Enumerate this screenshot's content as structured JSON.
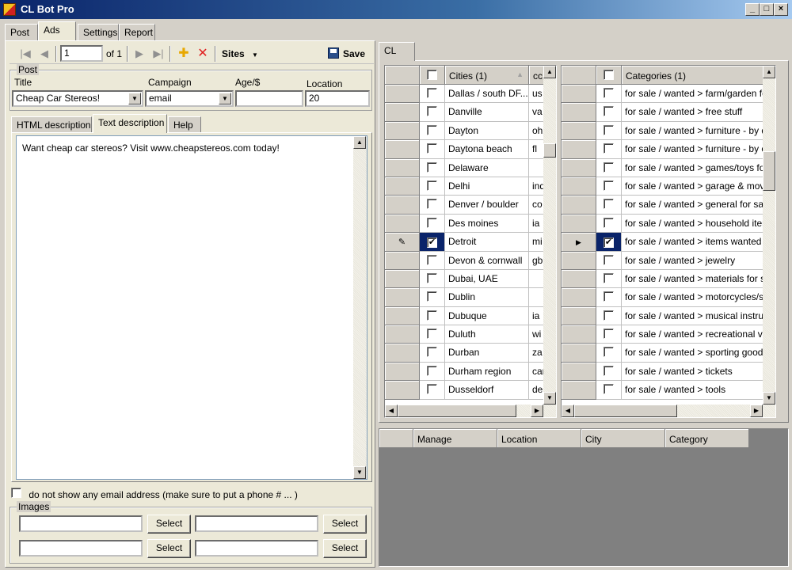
{
  "window": {
    "title": "CL Bot Pro",
    "minimize": "_",
    "maximize": "□",
    "close": "×"
  },
  "main_tabs": [
    "Post",
    "Ads",
    "Settings",
    "Report"
  ],
  "toolbar": {
    "first": "|◀",
    "prev": "◀",
    "record": "1",
    "of_label": "of 1",
    "next": "▶",
    "last": "▶|",
    "add_icon": "✚",
    "delete_icon": "✕",
    "sites_label": "Sites",
    "save_label": "Save"
  },
  "post": {
    "group_label": "Post",
    "title_label": "Title",
    "title_value": "Cheap Car Stereos!",
    "campaign_label": "Campaign",
    "campaign_value": "email",
    "age_label": "Age/$",
    "age_value": "",
    "location_label": "Location",
    "location_value": "20"
  },
  "desc_tabs": [
    "HTML description",
    "Text description",
    "Help"
  ],
  "description_text": "Want cheap car stereos?  Visit www.cheapstereos.com today!",
  "no_email_label": "do not show any email address (make sure to put a phone # ... )",
  "images": {
    "group_label": "Images",
    "select_label": "Select"
  },
  "site_tab": "CL",
  "cities": {
    "header": "Cities (1)",
    "code_header": "cc",
    "rows": [
      {
        "name": "Dallas / south DF...",
        "code": "us",
        "checked": false
      },
      {
        "name": "Danville",
        "code": "va",
        "checked": false
      },
      {
        "name": "Dayton",
        "code": "oh",
        "checked": false
      },
      {
        "name": "Daytona beach",
        "code": "fl",
        "checked": false
      },
      {
        "name": "Delaware",
        "code": "",
        "checked": false
      },
      {
        "name": "Delhi",
        "code": "ind",
        "checked": false
      },
      {
        "name": "Denver / boulder",
        "code": "co",
        "checked": false
      },
      {
        "name": "Des moines",
        "code": "ia",
        "checked": false
      },
      {
        "name": "Detroit",
        "code": "mi",
        "checked": true
      },
      {
        "name": "Devon & cornwall",
        "code": "gb",
        "checked": false
      },
      {
        "name": "Dubai, UAE",
        "code": "",
        "checked": false
      },
      {
        "name": "Dublin",
        "code": "",
        "checked": false
      },
      {
        "name": "Dubuque",
        "code": "ia",
        "checked": false
      },
      {
        "name": "Duluth",
        "code": "wi",
        "checked": false
      },
      {
        "name": "Durban",
        "code": "za",
        "checked": false
      },
      {
        "name": "Durham region",
        "code": "car",
        "checked": false
      },
      {
        "name": "Dusseldorf",
        "code": "de",
        "checked": false
      }
    ]
  },
  "categories": {
    "header": "Categories (1)",
    "rows": [
      {
        "name": "for sale / wanted > farm/garden for",
        "checked": false
      },
      {
        "name": "for sale / wanted > free stuff",
        "checked": false
      },
      {
        "name": "for sale / wanted > furniture - by de",
        "checked": false
      },
      {
        "name": "for sale / wanted > furniture - by ov",
        "checked": false
      },
      {
        "name": "for sale / wanted > games/toys for",
        "checked": false
      },
      {
        "name": "for sale / wanted > garage & movin",
        "checked": false
      },
      {
        "name": "for sale / wanted > general for sale",
        "checked": false
      },
      {
        "name": "for sale / wanted > household item",
        "checked": false
      },
      {
        "name": "for sale / wanted > items wanted",
        "checked": true
      },
      {
        "name": "for sale / wanted > jewelry",
        "checked": false
      },
      {
        "name": "for sale / wanted > materials for sal",
        "checked": false
      },
      {
        "name": "for sale / wanted > motorcycles/sc",
        "checked": false
      },
      {
        "name": "for sale / wanted > musical instrum",
        "checked": false
      },
      {
        "name": "for sale / wanted > recreational vel",
        "checked": false
      },
      {
        "name": "for sale / wanted > sporting goods",
        "checked": false
      },
      {
        "name": "for sale / wanted > tickets",
        "checked": false
      },
      {
        "name": "for sale / wanted > tools",
        "checked": false
      }
    ]
  },
  "report_grid": {
    "columns": [
      "Manage",
      "Location",
      "City",
      "Category"
    ]
  }
}
